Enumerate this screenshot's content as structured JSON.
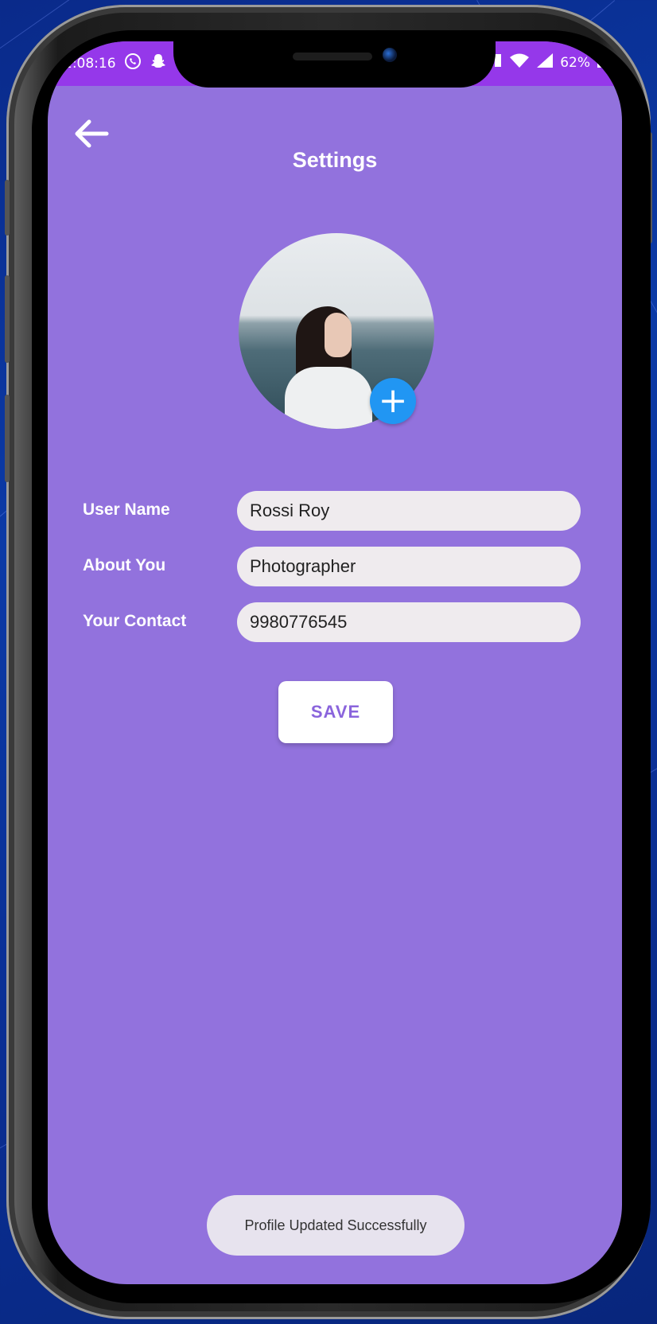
{
  "status_bar": {
    "time": "2:08:16",
    "battery": "62%",
    "icons": [
      "whatsapp-icon",
      "snapchat-icon",
      "wifi-icon",
      "signal-icon",
      "battery-icon"
    ]
  },
  "header": {
    "title": "Settings",
    "back_icon": "arrow-left-icon"
  },
  "profile": {
    "add_photo_icon": "plus-icon",
    "add_photo_label": "+"
  },
  "form": {
    "fields": [
      {
        "label": "User Name",
        "value": "Rossi Roy"
      },
      {
        "label": "About You",
        "value": "Photographer"
      },
      {
        "label": "Your Contact",
        "value": "9980776545"
      }
    ],
    "save_label": "SAVE"
  },
  "toast": {
    "message": "Profile Updated Successfully"
  },
  "colors": {
    "screen_bg": "#9272dd",
    "status_bar": "#9538ea",
    "fab_blue": "#2196f3",
    "input_bg": "#efebee",
    "save_text": "#8a64dc"
  }
}
